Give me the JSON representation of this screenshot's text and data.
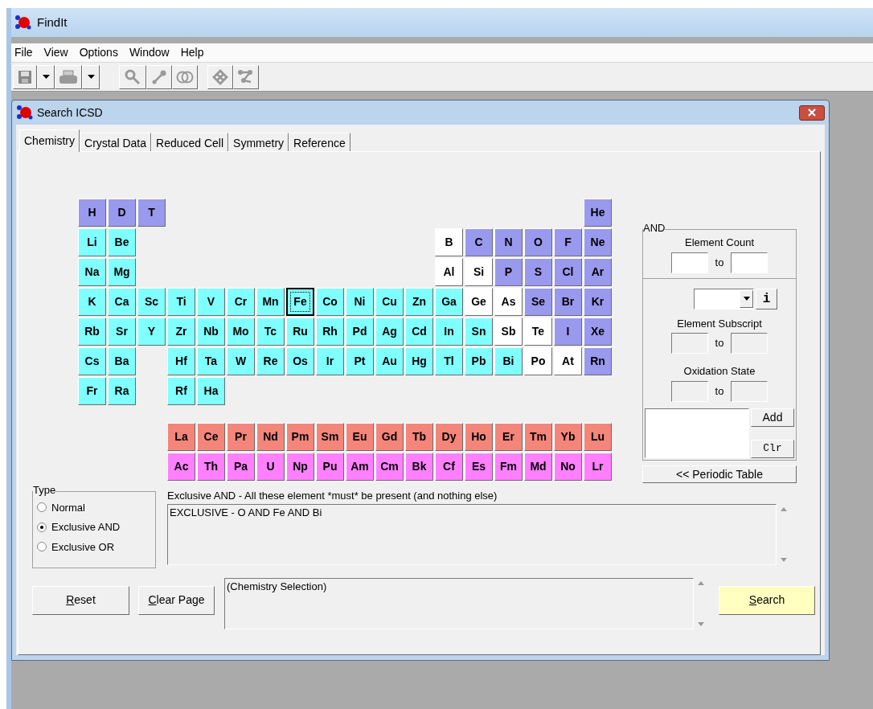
{
  "app": {
    "title": "FindIt"
  },
  "menu": [
    "File",
    "View",
    "Options",
    "Window",
    "Help"
  ],
  "dialog": {
    "title": "Search ICSD"
  },
  "tabs": [
    {
      "label": "Chemistry",
      "selected": true
    },
    {
      "label": "Crystal Data",
      "selected": false
    },
    {
      "label": "Reduced Cell",
      "selected": false
    },
    {
      "label": "Symmetry",
      "selected": false
    },
    {
      "label": "Reference",
      "selected": false
    }
  ],
  "periodic_table": {
    "rows": [
      [
        {
          "kind": "element",
          "symbol": "H",
          "color": "#9999ee",
          "focused": false
        },
        {
          "kind": "element",
          "symbol": "D",
          "color": "#9999ee",
          "focused": false
        },
        {
          "kind": "element",
          "symbol": "T",
          "color": "#9999ee",
          "focused": false
        },
        {
          "kind": "gap"
        },
        {
          "kind": "gap"
        },
        {
          "kind": "gap"
        },
        {
          "kind": "gap"
        },
        {
          "kind": "gap"
        },
        {
          "kind": "gap"
        },
        {
          "kind": "gap"
        },
        {
          "kind": "gap"
        },
        {
          "kind": "gap"
        },
        {
          "kind": "gap"
        },
        {
          "kind": "gap"
        },
        {
          "kind": "gap"
        },
        {
          "kind": "gap"
        },
        {
          "kind": "gap"
        },
        {
          "kind": "element",
          "symbol": "He",
          "color": "#9999ee",
          "focused": false
        }
      ],
      [
        {
          "kind": "element",
          "symbol": "Li",
          "color": "#80ffff",
          "focused": false
        },
        {
          "kind": "element",
          "symbol": "Be",
          "color": "#80ffff",
          "focused": false
        },
        {
          "kind": "gap"
        },
        {
          "kind": "gap"
        },
        {
          "kind": "gap"
        },
        {
          "kind": "gap"
        },
        {
          "kind": "gap"
        },
        {
          "kind": "gap"
        },
        {
          "kind": "gap"
        },
        {
          "kind": "gap"
        },
        {
          "kind": "gap"
        },
        {
          "kind": "gap"
        },
        {
          "kind": "element",
          "symbol": "B",
          "color": "#ffffff",
          "focused": false
        },
        {
          "kind": "element",
          "symbol": "C",
          "color": "#9999ee",
          "focused": false
        },
        {
          "kind": "element",
          "symbol": "N",
          "color": "#9999ee",
          "focused": false
        },
        {
          "kind": "element",
          "symbol": "O",
          "color": "#9999ee",
          "focused": false
        },
        {
          "kind": "element",
          "symbol": "F",
          "color": "#9999ee",
          "focused": false
        },
        {
          "kind": "element",
          "symbol": "Ne",
          "color": "#9999ee",
          "focused": false
        }
      ],
      [
        {
          "kind": "element",
          "symbol": "Na",
          "color": "#80ffff",
          "focused": false
        },
        {
          "kind": "element",
          "symbol": "Mg",
          "color": "#80ffff",
          "focused": false
        },
        {
          "kind": "gap"
        },
        {
          "kind": "gap"
        },
        {
          "kind": "gap"
        },
        {
          "kind": "gap"
        },
        {
          "kind": "gap"
        },
        {
          "kind": "gap"
        },
        {
          "kind": "gap"
        },
        {
          "kind": "gap"
        },
        {
          "kind": "gap"
        },
        {
          "kind": "gap"
        },
        {
          "kind": "element",
          "symbol": "Al",
          "color": "#ffffff",
          "focused": false
        },
        {
          "kind": "element",
          "symbol": "Si",
          "color": "#ffffff",
          "focused": false
        },
        {
          "kind": "element",
          "symbol": "P",
          "color": "#9999ee",
          "focused": false
        },
        {
          "kind": "element",
          "symbol": "S",
          "color": "#9999ee",
          "focused": false
        },
        {
          "kind": "element",
          "symbol": "Cl",
          "color": "#9999ee",
          "focused": false
        },
        {
          "kind": "element",
          "symbol": "Ar",
          "color": "#9999ee",
          "focused": false
        }
      ],
      [
        {
          "kind": "element",
          "symbol": "K",
          "color": "#80ffff",
          "focused": false
        },
        {
          "kind": "element",
          "symbol": "Ca",
          "color": "#80ffff",
          "focused": false
        },
        {
          "kind": "element",
          "symbol": "Sc",
          "color": "#80ffff",
          "focused": false
        },
        {
          "kind": "element",
          "symbol": "Ti",
          "color": "#80ffff",
          "focused": false
        },
        {
          "kind": "element",
          "symbol": "V",
          "color": "#80ffff",
          "focused": false
        },
        {
          "kind": "element",
          "symbol": "Cr",
          "color": "#80ffff",
          "focused": false
        },
        {
          "kind": "element",
          "symbol": "Mn",
          "color": "#80ffff",
          "focused": false
        },
        {
          "kind": "element",
          "symbol": "Fe",
          "color": "#80ffff",
          "focused": true
        },
        {
          "kind": "element",
          "symbol": "Co",
          "color": "#80ffff",
          "focused": false
        },
        {
          "kind": "element",
          "symbol": "Ni",
          "color": "#80ffff",
          "focused": false
        },
        {
          "kind": "element",
          "symbol": "Cu",
          "color": "#80ffff",
          "focused": false
        },
        {
          "kind": "element",
          "symbol": "Zn",
          "color": "#80ffff",
          "focused": false
        },
        {
          "kind": "element",
          "symbol": "Ga",
          "color": "#80ffff",
          "focused": false
        },
        {
          "kind": "element",
          "symbol": "Ge",
          "color": "#ffffff",
          "focused": false
        },
        {
          "kind": "element",
          "symbol": "As",
          "color": "#ffffff",
          "focused": false
        },
        {
          "kind": "element",
          "symbol": "Se",
          "color": "#9999ee",
          "focused": false
        },
        {
          "kind": "element",
          "symbol": "Br",
          "color": "#9999ee",
          "focused": false
        },
        {
          "kind": "element",
          "symbol": "Kr",
          "color": "#9999ee",
          "focused": false
        }
      ],
      [
        {
          "kind": "element",
          "symbol": "Rb",
          "color": "#80ffff",
          "focused": false
        },
        {
          "kind": "element",
          "symbol": "Sr",
          "color": "#80ffff",
          "focused": false
        },
        {
          "kind": "element",
          "symbol": "Y",
          "color": "#80ffff",
          "focused": false
        },
        {
          "kind": "element",
          "symbol": "Zr",
          "color": "#80ffff",
          "focused": false
        },
        {
          "kind": "element",
          "symbol": "Nb",
          "color": "#80ffff",
          "focused": false
        },
        {
          "kind": "element",
          "symbol": "Mo",
          "color": "#80ffff",
          "focused": false
        },
        {
          "kind": "element",
          "symbol": "Tc",
          "color": "#80ffff",
          "focused": false
        },
        {
          "kind": "element",
          "symbol": "Ru",
          "color": "#80ffff",
          "focused": false
        },
        {
          "kind": "element",
          "symbol": "Rh",
          "color": "#80ffff",
          "focused": false
        },
        {
          "kind": "element",
          "symbol": "Pd",
          "color": "#80ffff",
          "focused": false
        },
        {
          "kind": "element",
          "symbol": "Ag",
          "color": "#80ffff",
          "focused": false
        },
        {
          "kind": "element",
          "symbol": "Cd",
          "color": "#80ffff",
          "focused": false
        },
        {
          "kind": "element",
          "symbol": "In",
          "color": "#80ffff",
          "focused": false
        },
        {
          "kind": "element",
          "symbol": "Sn",
          "color": "#80ffff",
          "focused": false
        },
        {
          "kind": "element",
          "symbol": "Sb",
          "color": "#ffffff",
          "focused": false
        },
        {
          "kind": "element",
          "symbol": "Te",
          "color": "#ffffff",
          "focused": false
        },
        {
          "kind": "element",
          "symbol": "I",
          "color": "#9999ee",
          "focused": false
        },
        {
          "kind": "element",
          "symbol": "Xe",
          "color": "#9999ee",
          "focused": false
        }
      ],
      [
        {
          "kind": "element",
          "symbol": "Cs",
          "color": "#80ffff",
          "focused": false
        },
        {
          "kind": "element",
          "symbol": "Ba",
          "color": "#80ffff",
          "focused": false
        },
        {
          "kind": "gap"
        },
        {
          "kind": "element",
          "symbol": "Hf",
          "color": "#80ffff",
          "focused": false
        },
        {
          "kind": "element",
          "symbol": "Ta",
          "color": "#80ffff",
          "focused": false
        },
        {
          "kind": "element",
          "symbol": "W",
          "color": "#80ffff",
          "focused": false
        },
        {
          "kind": "element",
          "symbol": "Re",
          "color": "#80ffff",
          "focused": false
        },
        {
          "kind": "element",
          "symbol": "Os",
          "color": "#80ffff",
          "focused": false
        },
        {
          "kind": "element",
          "symbol": "Ir",
          "color": "#80ffff",
          "focused": false
        },
        {
          "kind": "element",
          "symbol": "Pt",
          "color": "#80ffff",
          "focused": false
        },
        {
          "kind": "element",
          "symbol": "Au",
          "color": "#80ffff",
          "focused": false
        },
        {
          "kind": "element",
          "symbol": "Hg",
          "color": "#80ffff",
          "focused": false
        },
        {
          "kind": "element",
          "symbol": "Tl",
          "color": "#80ffff",
          "focused": false
        },
        {
          "kind": "element",
          "symbol": "Pb",
          "color": "#80ffff",
          "focused": false
        },
        {
          "kind": "element",
          "symbol": "Bi",
          "color": "#80ffff",
          "focused": false
        },
        {
          "kind": "element",
          "symbol": "Po",
          "color": "#ffffff",
          "focused": false
        },
        {
          "kind": "element",
          "symbol": "At",
          "color": "#ffffff",
          "focused": false
        },
        {
          "kind": "element",
          "symbol": "Rn",
          "color": "#9999ee",
          "focused": false
        }
      ],
      [
        {
          "kind": "element",
          "symbol": "Fr",
          "color": "#80ffff",
          "focused": false
        },
        {
          "kind": "element",
          "symbol": "Ra",
          "color": "#80ffff",
          "focused": false
        },
        {
          "kind": "gap"
        },
        {
          "kind": "element",
          "symbol": "Rf",
          "color": "#80ffff",
          "focused": false
        },
        {
          "kind": "element",
          "symbol": "Ha",
          "color": "#80ffff",
          "focused": false
        }
      ]
    ],
    "f_rows": [
      [
        {
          "kind": "gap"
        },
        {
          "kind": "gap"
        },
        {
          "kind": "gap"
        },
        {
          "kind": "element",
          "symbol": "La",
          "color": "#f4857a",
          "focused": false
        },
        {
          "kind": "element",
          "symbol": "Ce",
          "color": "#f4857a",
          "focused": false
        },
        {
          "kind": "element",
          "symbol": "Pr",
          "color": "#f4857a",
          "focused": false
        },
        {
          "kind": "element",
          "symbol": "Nd",
          "color": "#f4857a",
          "focused": false
        },
        {
          "kind": "element",
          "symbol": "Pm",
          "color": "#f4857a",
          "focused": false
        },
        {
          "kind": "element",
          "symbol": "Sm",
          "color": "#f4857a",
          "focused": false
        },
        {
          "kind": "element",
          "symbol": "Eu",
          "color": "#f4857a",
          "focused": false
        },
        {
          "kind": "element",
          "symbol": "Gd",
          "color": "#f4857a",
          "focused": false
        },
        {
          "kind": "element",
          "symbol": "Tb",
          "color": "#f4857a",
          "focused": false
        },
        {
          "kind": "element",
          "symbol": "Dy",
          "color": "#f4857a",
          "focused": false
        },
        {
          "kind": "element",
          "symbol": "Ho",
          "color": "#f4857a",
          "focused": false
        },
        {
          "kind": "element",
          "symbol": "Er",
          "color": "#f4857a",
          "focused": false
        },
        {
          "kind": "element",
          "symbol": "Tm",
          "color": "#f4857a",
          "focused": false
        },
        {
          "kind": "element",
          "symbol": "Yb",
          "color": "#f4857a",
          "focused": false
        },
        {
          "kind": "element",
          "symbol": "Lu",
          "color": "#f4857a",
          "focused": false
        }
      ],
      [
        {
          "kind": "gap"
        },
        {
          "kind": "gap"
        },
        {
          "kind": "gap"
        },
        {
          "kind": "element",
          "symbol": "Ac",
          "color": "#ff80ff",
          "focused": false
        },
        {
          "kind": "element",
          "symbol": "Th",
          "color": "#ff80ff",
          "focused": false
        },
        {
          "kind": "element",
          "symbol": "Pa",
          "color": "#ff80ff",
          "focused": false
        },
        {
          "kind": "element",
          "symbol": "U",
          "color": "#ff80ff",
          "focused": false
        },
        {
          "kind": "element",
          "symbol": "Np",
          "color": "#ff80ff",
          "focused": false
        },
        {
          "kind": "element",
          "symbol": "Pu",
          "color": "#ff80ff",
          "focused": false
        },
        {
          "kind": "element",
          "symbol": "Am",
          "color": "#ff80ff",
          "focused": false
        },
        {
          "kind": "element",
          "symbol": "Cm",
          "color": "#ff80ff",
          "focused": false
        },
        {
          "kind": "element",
          "symbol": "Bk",
          "color": "#ff80ff",
          "focused": false
        },
        {
          "kind": "element",
          "symbol": "Cf",
          "color": "#ff80ff",
          "focused": false
        },
        {
          "kind": "element",
          "symbol": "Es",
          "color": "#ff80ff",
          "focused": false
        },
        {
          "kind": "element",
          "symbol": "Fm",
          "color": "#ff80ff",
          "focused": false
        },
        {
          "kind": "element",
          "symbol": "Md",
          "color": "#ff80ff",
          "focused": false
        },
        {
          "kind": "element",
          "symbol": "No",
          "color": "#ff80ff",
          "focused": false
        },
        {
          "kind": "element",
          "symbol": "Lr",
          "color": "#ff80ff",
          "focused": false
        }
      ]
    ]
  },
  "and_panel": {
    "legend": "AND",
    "element_count": {
      "label": "Element Count",
      "to": "to",
      "from_disabled": false,
      "to_disabled": false
    },
    "element_subscript": {
      "label": "Element Subscript",
      "to": "to",
      "from_disabled": true,
      "to_disabled": true
    },
    "oxidation_state": {
      "label": "Oxidation State",
      "to": "to",
      "from_disabled": true,
      "to_disabled": true
    },
    "info_button": "i",
    "add_button": "Add",
    "clear_button": "Clr",
    "periodic_button": "<< Periodic Table"
  },
  "type_group": {
    "legend": "Type",
    "options": [
      {
        "label": "Normal",
        "selected": false
      },
      {
        "label": "Exclusive AND",
        "selected": true
      },
      {
        "label": "Exclusive OR",
        "selected": false
      }
    ]
  },
  "description": "Exclusive AND - All these element *must* be present (and nothing else)",
  "query_text": "EXCLUSIVE - O AND Fe AND Bi",
  "selection_text": "(Chemistry Selection)",
  "buttons": [
    {
      "label": "Reset",
      "underline_first": true
    },
    {
      "label": "Clear Page",
      "underline_first": true
    }
  ],
  "search_button": {
    "label": "Search",
    "underline_first": true
  }
}
